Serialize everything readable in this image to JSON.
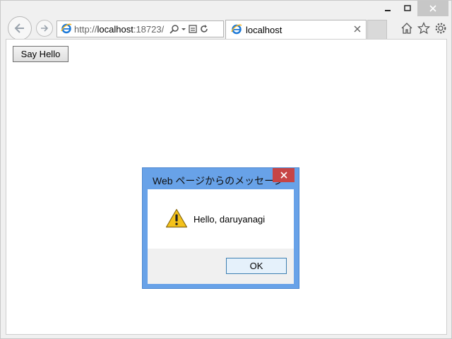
{
  "browser": {
    "address": {
      "scheme": "http://",
      "host": "localhost",
      "port_path": ":18723/"
    },
    "tab": {
      "title": "localhost"
    }
  },
  "page": {
    "say_hello_label": "Say Hello"
  },
  "dialog": {
    "title": "Web ページからのメッセージ",
    "message": "Hello, daruyanagi",
    "ok_label": "OK"
  },
  "colors": {
    "dialog_frame": "#68a2e8",
    "dialog_close": "#c74545",
    "ok_button": "#e5f1fb"
  }
}
